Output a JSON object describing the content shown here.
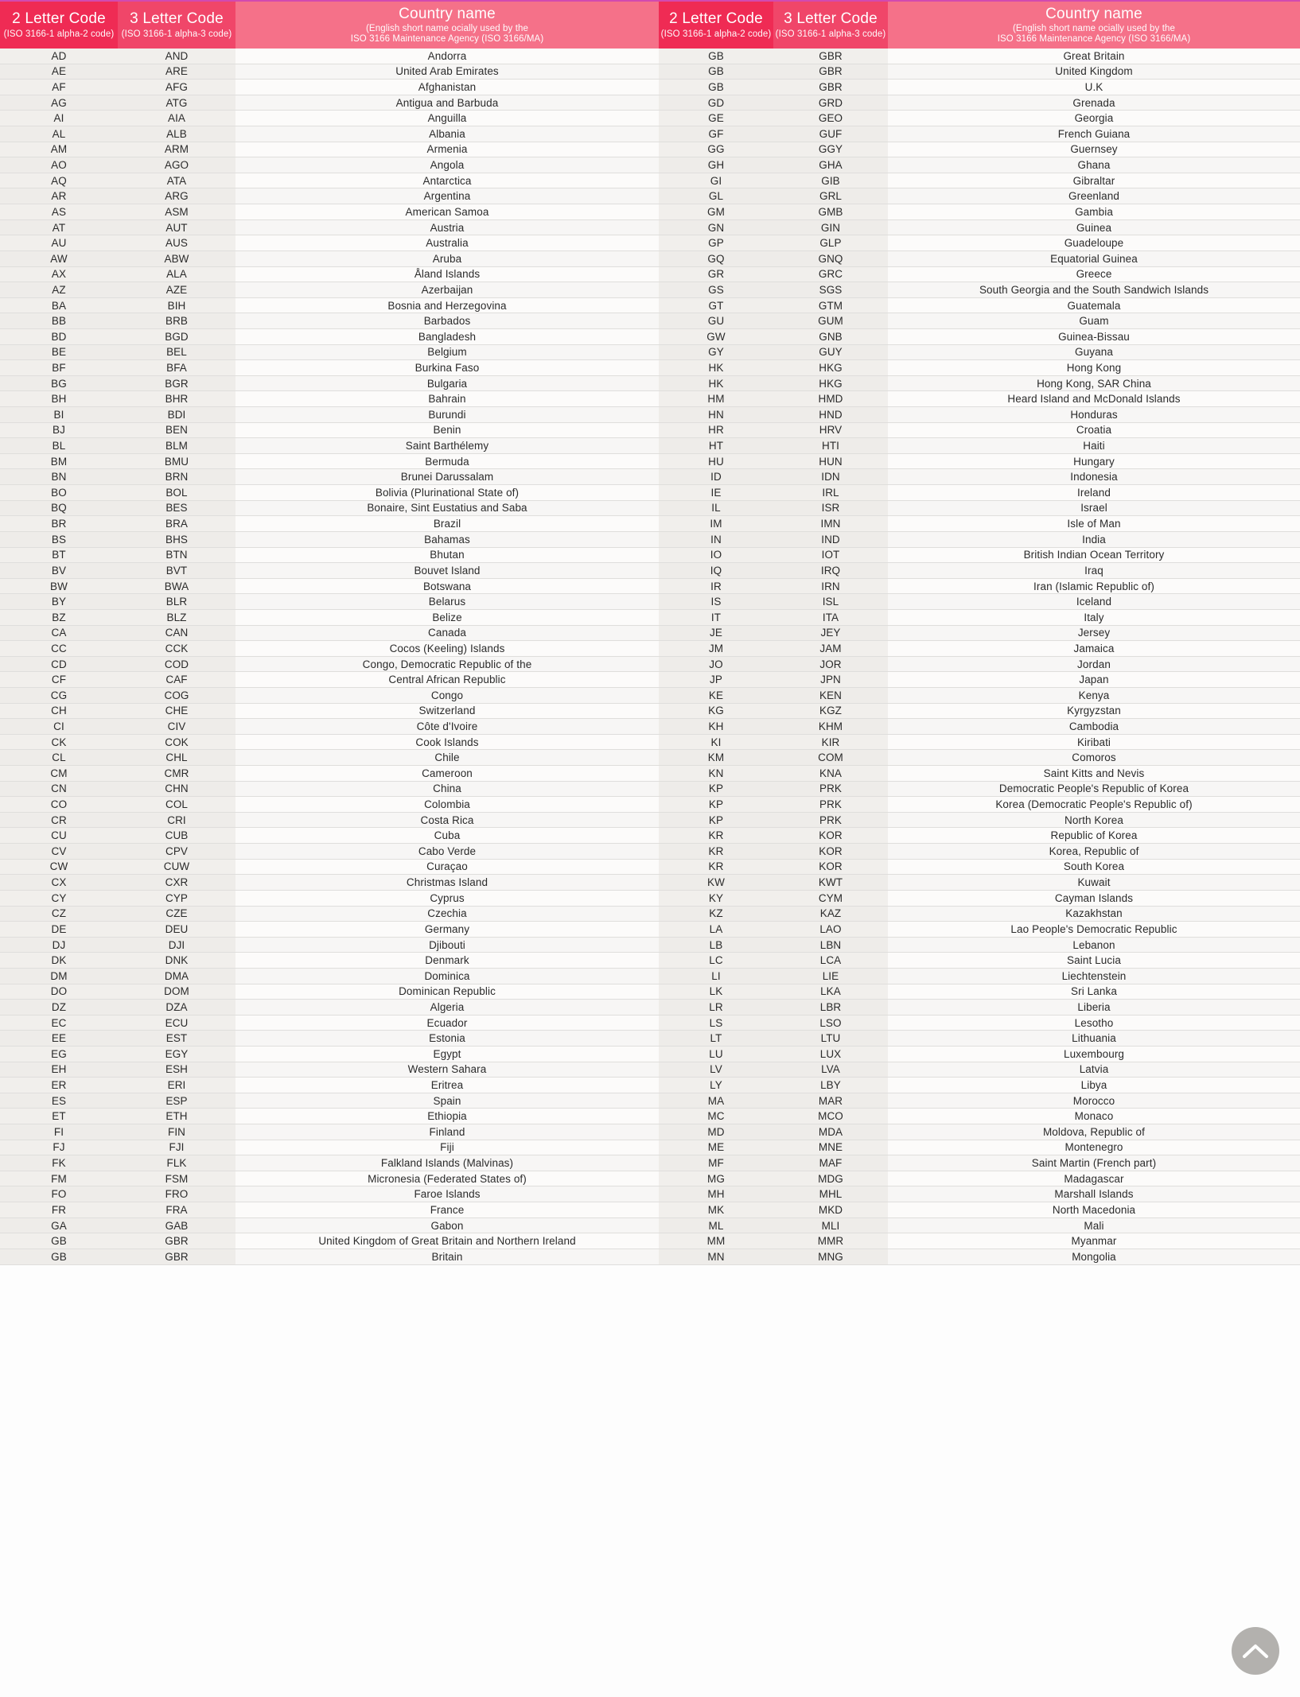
{
  "header": {
    "col_2letter": {
      "title": "2 Letter Code",
      "subtitle": "(ISO 3166-1 alpha-2 code)"
    },
    "col_3letter": {
      "title": "3 Letter Code",
      "subtitle": "(ISO 3166-1 alpha-3 code)"
    },
    "col_country": {
      "title": "Country name",
      "subtitle_line1": "(English short name ocially used by the",
      "subtitle_line2": "ISO 3166 Maintenance Agency (ISO 3166/MA)"
    }
  },
  "colors": {
    "header_2letter_bg": "#ef2b54",
    "header_3letter_bg": "#f04669",
    "header_country_bg": "#f57189",
    "top_accent": "#d24ab0",
    "row_code_bg": "#efedea",
    "row_name_bg": "#fafaf9",
    "row_border": "#dfdedc",
    "text": "#2b2b2b",
    "scroll_button_bg": "#b3b1ae"
  },
  "scroll_top_button": {
    "icon": "chevron-up-icon",
    "label": "Scroll to top"
  },
  "left_table": [
    {
      "a2": "AD",
      "a3": "AND",
      "name": "Andorra"
    },
    {
      "a2": "AE",
      "a3": "ARE",
      "name": "United Arab Emirates"
    },
    {
      "a2": "AF",
      "a3": "AFG",
      "name": "Afghanistan"
    },
    {
      "a2": "AG",
      "a3": "ATG",
      "name": "Antigua and Barbuda"
    },
    {
      "a2": "AI",
      "a3": "AIA",
      "name": "Anguilla"
    },
    {
      "a2": "AL",
      "a3": "ALB",
      "name": "Albania"
    },
    {
      "a2": "AM",
      "a3": "ARM",
      "name": "Armenia"
    },
    {
      "a2": "AO",
      "a3": "AGO",
      "name": "Angola"
    },
    {
      "a2": "AQ",
      "a3": "ATA",
      "name": "Antarctica"
    },
    {
      "a2": "AR",
      "a3": "ARG",
      "name": "Argentina"
    },
    {
      "a2": "AS",
      "a3": "ASM",
      "name": "American Samoa"
    },
    {
      "a2": "AT",
      "a3": "AUT",
      "name": "Austria"
    },
    {
      "a2": "AU",
      "a3": "AUS",
      "name": "Australia"
    },
    {
      "a2": "AW",
      "a3": "ABW",
      "name": "Aruba"
    },
    {
      "a2": "AX",
      "a3": "ALA",
      "name": "Åland Islands"
    },
    {
      "a2": "AZ",
      "a3": "AZE",
      "name": "Azerbaijan"
    },
    {
      "a2": "BA",
      "a3": "BIH",
      "name": "Bosnia and Herzegovina"
    },
    {
      "a2": "BB",
      "a3": "BRB",
      "name": "Barbados"
    },
    {
      "a2": "BD",
      "a3": "BGD",
      "name": "Bangladesh"
    },
    {
      "a2": "BE",
      "a3": "BEL",
      "name": "Belgium"
    },
    {
      "a2": "BF",
      "a3": "BFA",
      "name": "Burkina Faso"
    },
    {
      "a2": "BG",
      "a3": "BGR",
      "name": "Bulgaria"
    },
    {
      "a2": "BH",
      "a3": "BHR",
      "name": "Bahrain"
    },
    {
      "a2": "BI",
      "a3": "BDI",
      "name": "Burundi"
    },
    {
      "a2": "BJ",
      "a3": "BEN",
      "name": "Benin"
    },
    {
      "a2": "BL",
      "a3": "BLM",
      "name": "Saint Barthélemy"
    },
    {
      "a2": "BM",
      "a3": "BMU",
      "name": "Bermuda"
    },
    {
      "a2": "BN",
      "a3": "BRN",
      "name": "Brunei Darussalam"
    },
    {
      "a2": "BO",
      "a3": "BOL",
      "name": "Bolivia (Plurinational State of)"
    },
    {
      "a2": "BQ",
      "a3": "BES",
      "name": "Bonaire, Sint Eustatius and Saba"
    },
    {
      "a2": "BR",
      "a3": "BRA",
      "name": "Brazil"
    },
    {
      "a2": "BS",
      "a3": "BHS",
      "name": "Bahamas"
    },
    {
      "a2": "BT",
      "a3": "BTN",
      "name": "Bhutan"
    },
    {
      "a2": "BV",
      "a3": "BVT",
      "name": "Bouvet Island"
    },
    {
      "a2": "BW",
      "a3": "BWA",
      "name": "Botswana"
    },
    {
      "a2": "BY",
      "a3": "BLR",
      "name": "Belarus"
    },
    {
      "a2": "BZ",
      "a3": "BLZ",
      "name": "Belize"
    },
    {
      "a2": "CA",
      "a3": "CAN",
      "name": "Canada"
    },
    {
      "a2": "CC",
      "a3": "CCK",
      "name": "Cocos (Keeling) Islands"
    },
    {
      "a2": "CD",
      "a3": "COD",
      "name": "Congo, Democratic Republic of the"
    },
    {
      "a2": "CF",
      "a3": "CAF",
      "name": "Central African Republic"
    },
    {
      "a2": "CG",
      "a3": "COG",
      "name": "Congo"
    },
    {
      "a2": "CH",
      "a3": "CHE",
      "name": "Switzerland"
    },
    {
      "a2": "CI",
      "a3": "CIV",
      "name": "Côte d'Ivoire"
    },
    {
      "a2": "CK",
      "a3": "COK",
      "name": "Cook Islands"
    },
    {
      "a2": "CL",
      "a3": "CHL",
      "name": "Chile"
    },
    {
      "a2": "CM",
      "a3": "CMR",
      "name": "Cameroon"
    },
    {
      "a2": "CN",
      "a3": "CHN",
      "name": "China"
    },
    {
      "a2": "CO",
      "a3": "COL",
      "name": "Colombia"
    },
    {
      "a2": "CR",
      "a3": "CRI",
      "name": "Costa Rica"
    },
    {
      "a2": "CU",
      "a3": "CUB",
      "name": "Cuba"
    },
    {
      "a2": "CV",
      "a3": "CPV",
      "name": "Cabo Verde"
    },
    {
      "a2": "CW",
      "a3": "CUW",
      "name": "Curaçao"
    },
    {
      "a2": "CX",
      "a3": "CXR",
      "name": "Christmas Island"
    },
    {
      "a2": "CY",
      "a3": "CYP",
      "name": "Cyprus"
    },
    {
      "a2": "CZ",
      "a3": "CZE",
      "name": "Czechia"
    },
    {
      "a2": "DE",
      "a3": "DEU",
      "name": "Germany"
    },
    {
      "a2": "DJ",
      "a3": "DJI",
      "name": "Djibouti"
    },
    {
      "a2": "DK",
      "a3": "DNK",
      "name": "Denmark"
    },
    {
      "a2": "DM",
      "a3": "DMA",
      "name": "Dominica"
    },
    {
      "a2": "DO",
      "a3": "DOM",
      "name": "Dominican Republic"
    },
    {
      "a2": "DZ",
      "a3": "DZA",
      "name": "Algeria"
    },
    {
      "a2": "EC",
      "a3": "ECU",
      "name": "Ecuador"
    },
    {
      "a2": "EE",
      "a3": "EST",
      "name": "Estonia"
    },
    {
      "a2": "EG",
      "a3": "EGY",
      "name": "Egypt"
    },
    {
      "a2": "EH",
      "a3": "ESH",
      "name": "Western Sahara"
    },
    {
      "a2": "ER",
      "a3": "ERI",
      "name": "Eritrea"
    },
    {
      "a2": "ES",
      "a3": "ESP",
      "name": "Spain"
    },
    {
      "a2": "ET",
      "a3": "ETH",
      "name": "Ethiopia"
    },
    {
      "a2": "FI",
      "a3": "FIN",
      "name": "Finland"
    },
    {
      "a2": "FJ",
      "a3": "FJI",
      "name": "Fiji"
    },
    {
      "a2": "FK",
      "a3": "FLK",
      "name": "Falkland Islands (Malvinas)"
    },
    {
      "a2": "FM",
      "a3": "FSM",
      "name": "Micronesia (Federated States of)"
    },
    {
      "a2": "FO",
      "a3": "FRO",
      "name": "Faroe Islands"
    },
    {
      "a2": "FR",
      "a3": "FRA",
      "name": "France"
    },
    {
      "a2": "GA",
      "a3": "GAB",
      "name": "Gabon"
    },
    {
      "a2": "GB",
      "a3": "GBR",
      "name": "United Kingdom of Great Britain and Northern Ireland"
    },
    {
      "a2": "GB",
      "a3": "GBR",
      "name": "Britain"
    }
  ],
  "right_table": [
    {
      "a2": "GB",
      "a3": "GBR",
      "name": "Great Britain"
    },
    {
      "a2": "GB",
      "a3": "GBR",
      "name": "United Kingdom"
    },
    {
      "a2": "GB",
      "a3": "GBR",
      "name": "U.K"
    },
    {
      "a2": "GD",
      "a3": "GRD",
      "name": "Grenada"
    },
    {
      "a2": "GE",
      "a3": "GEO",
      "name": "Georgia"
    },
    {
      "a2": "GF",
      "a3": "GUF",
      "name": "French Guiana"
    },
    {
      "a2": "GG",
      "a3": "GGY",
      "name": "Guernsey"
    },
    {
      "a2": "GH",
      "a3": "GHA",
      "name": "Ghana"
    },
    {
      "a2": "GI",
      "a3": "GIB",
      "name": "Gibraltar"
    },
    {
      "a2": "GL",
      "a3": "GRL",
      "name": "Greenland"
    },
    {
      "a2": "GM",
      "a3": "GMB",
      "name": "Gambia"
    },
    {
      "a2": "GN",
      "a3": "GIN",
      "name": "Guinea"
    },
    {
      "a2": "GP",
      "a3": "GLP",
      "name": "Guadeloupe"
    },
    {
      "a2": "GQ",
      "a3": "GNQ",
      "name": "Equatorial Guinea"
    },
    {
      "a2": "GR",
      "a3": "GRC",
      "name": "Greece"
    },
    {
      "a2": "GS",
      "a3": "SGS",
      "name": "South Georgia and the South Sandwich Islands"
    },
    {
      "a2": "GT",
      "a3": "GTM",
      "name": "Guatemala"
    },
    {
      "a2": "GU",
      "a3": "GUM",
      "name": "Guam"
    },
    {
      "a2": "GW",
      "a3": "GNB",
      "name": "Guinea-Bissau"
    },
    {
      "a2": "GY",
      "a3": "GUY",
      "name": "Guyana"
    },
    {
      "a2": "HK",
      "a3": "HKG",
      "name": "Hong Kong"
    },
    {
      "a2": "HK",
      "a3": "HKG",
      "name": "Hong Kong, SAR China"
    },
    {
      "a2": "HM",
      "a3": "HMD",
      "name": "Heard Island and McDonald Islands"
    },
    {
      "a2": "HN",
      "a3": "HND",
      "name": "Honduras"
    },
    {
      "a2": "HR",
      "a3": "HRV",
      "name": "Croatia"
    },
    {
      "a2": "HT",
      "a3": "HTI",
      "name": "Haiti"
    },
    {
      "a2": "HU",
      "a3": "HUN",
      "name": "Hungary"
    },
    {
      "a2": "ID",
      "a3": "IDN",
      "name": "Indonesia"
    },
    {
      "a2": "IE",
      "a3": "IRL",
      "name": "Ireland"
    },
    {
      "a2": "IL",
      "a3": "ISR",
      "name": "Israel"
    },
    {
      "a2": "IM",
      "a3": "IMN",
      "name": "Isle of Man"
    },
    {
      "a2": "IN",
      "a3": "IND",
      "name": "India"
    },
    {
      "a2": "IO",
      "a3": "IOT",
      "name": "British Indian Ocean Territory"
    },
    {
      "a2": "IQ",
      "a3": "IRQ",
      "name": "Iraq"
    },
    {
      "a2": "IR",
      "a3": "IRN",
      "name": "Iran (Islamic Republic of)"
    },
    {
      "a2": "IS",
      "a3": "ISL",
      "name": "Iceland"
    },
    {
      "a2": "IT",
      "a3": "ITA",
      "name": "Italy"
    },
    {
      "a2": "JE",
      "a3": "JEY",
      "name": "Jersey"
    },
    {
      "a2": "JM",
      "a3": "JAM",
      "name": "Jamaica"
    },
    {
      "a2": "JO",
      "a3": "JOR",
      "name": "Jordan"
    },
    {
      "a2": "JP",
      "a3": "JPN",
      "name": "Japan"
    },
    {
      "a2": "KE",
      "a3": "KEN",
      "name": "Kenya"
    },
    {
      "a2": "KG",
      "a3": "KGZ",
      "name": "Kyrgyzstan"
    },
    {
      "a2": "KH",
      "a3": "KHM",
      "name": "Cambodia"
    },
    {
      "a2": "KI",
      "a3": "KIR",
      "name": "Kiribati"
    },
    {
      "a2": "KM",
      "a3": "COM",
      "name": "Comoros"
    },
    {
      "a2": "KN",
      "a3": "KNA",
      "name": "Saint Kitts and Nevis"
    },
    {
      "a2": "KP",
      "a3": "PRK",
      "name": "Democratic People's Republic of Korea"
    },
    {
      "a2": "KP",
      "a3": "PRK",
      "name": "Korea (Democratic People's Republic of)"
    },
    {
      "a2": "KP",
      "a3": "PRK",
      "name": "North Korea"
    },
    {
      "a2": "KR",
      "a3": "KOR",
      "name": "Republic of Korea"
    },
    {
      "a2": "KR",
      "a3": "KOR",
      "name": "Korea, Republic of"
    },
    {
      "a2": "KR",
      "a3": "KOR",
      "name": "South Korea"
    },
    {
      "a2": "KW",
      "a3": "KWT",
      "name": "Kuwait"
    },
    {
      "a2": "KY",
      "a3": "CYM",
      "name": "Cayman Islands"
    },
    {
      "a2": "KZ",
      "a3": "KAZ",
      "name": "Kazakhstan"
    },
    {
      "a2": "LA",
      "a3": "LAO",
      "name": "Lao People's Democratic Republic"
    },
    {
      "a2": "LB",
      "a3": "LBN",
      "name": "Lebanon"
    },
    {
      "a2": "LC",
      "a3": "LCA",
      "name": "Saint Lucia"
    },
    {
      "a2": "LI",
      "a3": "LIE",
      "name": "Liechtenstein"
    },
    {
      "a2": "LK",
      "a3": "LKA",
      "name": "Sri Lanka"
    },
    {
      "a2": "LR",
      "a3": "LBR",
      "name": "Liberia"
    },
    {
      "a2": "LS",
      "a3": "LSO",
      "name": "Lesotho"
    },
    {
      "a2": "LT",
      "a3": "LTU",
      "name": "Lithuania"
    },
    {
      "a2": "LU",
      "a3": "LUX",
      "name": "Luxembourg"
    },
    {
      "a2": "LV",
      "a3": "LVA",
      "name": "Latvia"
    },
    {
      "a2": "LY",
      "a3": "LBY",
      "name": "Libya"
    },
    {
      "a2": "MA",
      "a3": "MAR",
      "name": "Morocco"
    },
    {
      "a2": "MC",
      "a3": "MCO",
      "name": "Monaco"
    },
    {
      "a2": "MD",
      "a3": "MDA",
      "name": "Moldova, Republic of"
    },
    {
      "a2": "ME",
      "a3": "MNE",
      "name": "Montenegro"
    },
    {
      "a2": "MF",
      "a3": "MAF",
      "name": "Saint Martin (French part)"
    },
    {
      "a2": "MG",
      "a3": "MDG",
      "name": "Madagascar"
    },
    {
      "a2": "MH",
      "a3": "MHL",
      "name": "Marshall Islands"
    },
    {
      "a2": "MK",
      "a3": "MKD",
      "name": "North Macedonia"
    },
    {
      "a2": "ML",
      "a3": "MLI",
      "name": "Mali"
    },
    {
      "a2": "MM",
      "a3": "MMR",
      "name": "Myanmar"
    },
    {
      "a2": "MN",
      "a3": "MNG",
      "name": "Mongolia"
    }
  ]
}
